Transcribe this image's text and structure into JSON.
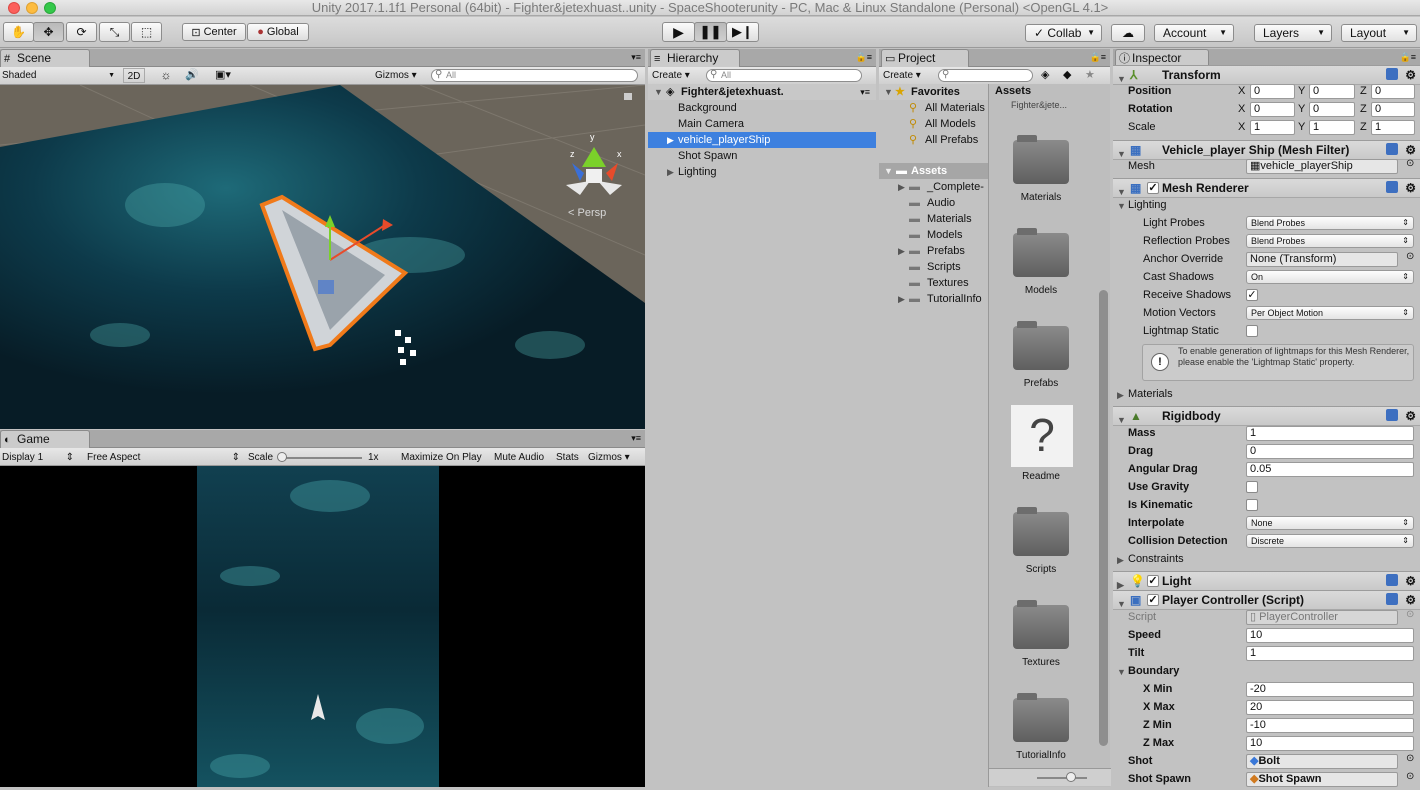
{
  "window": {
    "title": "Unity 2017.1.1f1 Personal (64bit) - Fighter&jetexhuast..unity - SpaceShooterunity - PC, Mac & Linux Standalone (Personal) <OpenGL 4.1>"
  },
  "toolbar": {
    "pivot_label": "Center",
    "space_label": "Global",
    "collab_label": "Collab",
    "account_label": "Account",
    "layers_label": "Layers",
    "layout_label": "Layout"
  },
  "scene": {
    "tab_label": "Scene",
    "shading_mode": "Shaded",
    "mode_2d": "2D",
    "gizmos_label": "Gizmos",
    "search_placeholder": "All",
    "persp_label": "Persp",
    "axis_y": "y",
    "axis_x": "x",
    "axis_z": "z"
  },
  "game": {
    "tab_label": "Game",
    "display": "Display 1",
    "aspect": "Free Aspect",
    "scale_label": "Scale",
    "scale_value": "1x",
    "maximize_on_play": "Maximize On Play",
    "mute_audio": "Mute Audio",
    "stats": "Stats",
    "gizmos": "Gizmos"
  },
  "hierarchy": {
    "tab_label": "Hierarchy",
    "create_label": "Create",
    "search_placeholder": "All",
    "scene_name": "Fighter&jetexhuast.",
    "items": [
      "Background",
      "Main Camera",
      "vehicle_playerShip",
      "Shot Spawn",
      "Lighting"
    ]
  },
  "project": {
    "tab_label": "Project",
    "create_label": "Create",
    "favorites_label": "Favorites",
    "favorites": [
      "All Materials",
      "All Models",
      "All Prefabs"
    ],
    "assets_label": "Assets",
    "asset_tree": [
      "_Complete-",
      "Audio",
      "Materials",
      "Models",
      "Prefabs",
      "Scripts",
      "Textures",
      "TutorialInfo"
    ],
    "grid_header": "Assets",
    "grid_subheader": "Fighter&jete...",
    "grid_items": [
      "Materials",
      "Models",
      "Prefabs",
      "Readme",
      "Scripts",
      "Textures",
      "TutorialInfo"
    ]
  },
  "inspector": {
    "tab_label": "Inspector",
    "transform": {
      "title": "Transform",
      "position_label": "Position",
      "rotation_label": "Rotation",
      "scale_label": "Scale",
      "axis_x": "X",
      "axis_y": "Y",
      "axis_z": "Z",
      "position": [
        "0",
        "0",
        "0"
      ],
      "rotation": [
        "0",
        "0",
        "0"
      ],
      "scale": [
        "1",
        "1",
        "1"
      ]
    },
    "mesh_filter": {
      "title": "Vehicle_player Ship (Mesh Filter)",
      "mesh_label": "Mesh",
      "mesh_value": "vehicle_playerShip"
    },
    "mesh_renderer": {
      "title": "Mesh Renderer",
      "lighting_label": "Lighting",
      "light_probes_label": "Light Probes",
      "light_probes_value": "Blend Probes",
      "reflection_probes_label": "Reflection Probes",
      "reflection_probes_value": "Blend Probes",
      "anchor_override_label": "Anchor Override",
      "anchor_override_value": "None (Transform)",
      "cast_shadows_label": "Cast Shadows",
      "cast_shadows_value": "On",
      "receive_shadows_label": "Receive Shadows",
      "motion_vectors_label": "Motion Vectors",
      "motion_vectors_value": "Per Object Motion",
      "lightmap_static_label": "Lightmap Static",
      "info_text": "To enable generation of lightmaps for this Mesh Renderer, please enable the 'Lightmap Static' property.",
      "materials_label": "Materials"
    },
    "rigidbody": {
      "title": "Rigidbody",
      "mass_label": "Mass",
      "mass": "1",
      "drag_label": "Drag",
      "drag": "0",
      "angular_drag_label": "Angular Drag",
      "angular_drag": "0.05",
      "use_gravity_label": "Use Gravity",
      "is_kinematic_label": "Is Kinematic",
      "interpolate_label": "Interpolate",
      "interpolate_value": "None",
      "collision_label": "Collision Detection",
      "collision_value": "Discrete",
      "constraints_label": "Constraints"
    },
    "light": {
      "title": "Light"
    },
    "player_controller": {
      "title": "Player Controller (Script)",
      "script_label": "Script",
      "script_value": "PlayerController",
      "speed_label": "Speed",
      "speed": "10",
      "tilt_label": "Tilt",
      "tilt": "1",
      "boundary_label": "Boundary",
      "xmin_label": "X Min",
      "xmin": "-20",
      "xmax_label": "X Max",
      "xmax": "20",
      "zmin_label": "Z Min",
      "zmin": "-10",
      "zmax_label": "Z Max",
      "zmax": "10",
      "shot_label": "Shot",
      "shot_value": "Bolt",
      "shot_spawn_label": "Shot Spawn",
      "shot_spawn_value": "Shot Spawn"
    }
  },
  "colors": {
    "selection": "#3d80df",
    "accent_orange": "#f07a1a",
    "scene_ground": "#6b655b",
    "nebula": "#0d3a4a"
  }
}
